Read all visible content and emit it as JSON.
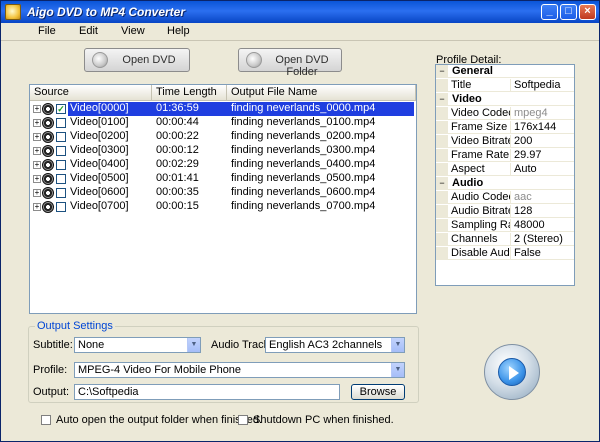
{
  "window": {
    "title": "Aigo DVD to MP4 Converter",
    "accent": "#1f3ee0"
  },
  "titlebar_buttons": {
    "minimize": "_",
    "maximize": "□",
    "close": "×"
  },
  "menu": [
    "File",
    "Edit",
    "View",
    "Help"
  ],
  "toolbar": {
    "open_dvd": "Open DVD",
    "open_dvd_folder": "Open DVD Folder"
  },
  "list": {
    "headers": [
      "Source",
      "Time Length",
      "Output File Name"
    ],
    "rows": [
      {
        "source": "Video[0000]",
        "time": "01:36:59",
        "output": "finding neverlands_0000.mp4",
        "checked": true,
        "selected": true
      },
      {
        "source": "Video[0100]",
        "time": "00:00:44",
        "output": "finding neverlands_0100.mp4",
        "checked": false,
        "selected": false
      },
      {
        "source": "Video[0200]",
        "time": "00:00:22",
        "output": "finding neverlands_0200.mp4",
        "checked": false,
        "selected": false
      },
      {
        "source": "Video[0300]",
        "time": "00:00:12",
        "output": "finding neverlands_0300.mp4",
        "checked": false,
        "selected": false
      },
      {
        "source": "Video[0400]",
        "time": "00:02:29",
        "output": "finding neverlands_0400.mp4",
        "checked": false,
        "selected": false
      },
      {
        "source": "Video[0500]",
        "time": "00:01:41",
        "output": "finding neverlands_0500.mp4",
        "checked": false,
        "selected": false
      },
      {
        "source": "Video[0600]",
        "time": "00:00:35",
        "output": "finding neverlands_0600.mp4",
        "checked": false,
        "selected": false
      },
      {
        "source": "Video[0700]",
        "time": "00:00:15",
        "output": "finding neverlands_0700.mp4",
        "checked": false,
        "selected": false
      }
    ],
    "expander_glyph": "+",
    "check_glyph": "✓"
  },
  "profile": {
    "label": "Profile Detail:",
    "categories": [
      {
        "name": "General",
        "items": [
          {
            "name": "Title",
            "value": "Softpedia",
            "dim": false
          }
        ]
      },
      {
        "name": "Video",
        "items": [
          {
            "name": "Video Codec",
            "value": "mpeg4",
            "dim": true
          },
          {
            "name": "Frame Size",
            "value": "176x144",
            "dim": false
          },
          {
            "name": "Video Bitrate",
            "value": "200",
            "dim": false
          },
          {
            "name": "Frame Rate",
            "value": "29.97",
            "dim": false
          },
          {
            "name": "Aspect",
            "value": "Auto",
            "dim": false
          }
        ]
      },
      {
        "name": "Audio",
        "items": [
          {
            "name": "Audio Codec",
            "value": "aac",
            "dim": true
          },
          {
            "name": "Audio Bitrate",
            "value": "128",
            "dim": false
          },
          {
            "name": "Sampling Rate",
            "value": "48000",
            "dim": false
          },
          {
            "name": "Channels",
            "value": "2 (Stereo)",
            "dim": false
          },
          {
            "name": "Disable Audio",
            "value": "False",
            "dim": false
          }
        ]
      }
    ],
    "collapse_glyph": "−"
  },
  "output_settings": {
    "title": "Output Settings",
    "subtitle_label": "Subtitle:",
    "subtitle_value": "None",
    "audio_track_label": "Audio Track:",
    "audio_track_value": "English AC3 2channels",
    "profile_label": "Profile:",
    "profile_value": "MPEG-4 Video For Mobile Phone",
    "output_label": "Output:",
    "output_value": "C:\\Softpedia",
    "browse_label": "Browse",
    "dropdown_glyph": "▼"
  },
  "options": {
    "auto_open": "Auto open the output folder when finished.",
    "shutdown": "Shutdown PC when finished."
  }
}
